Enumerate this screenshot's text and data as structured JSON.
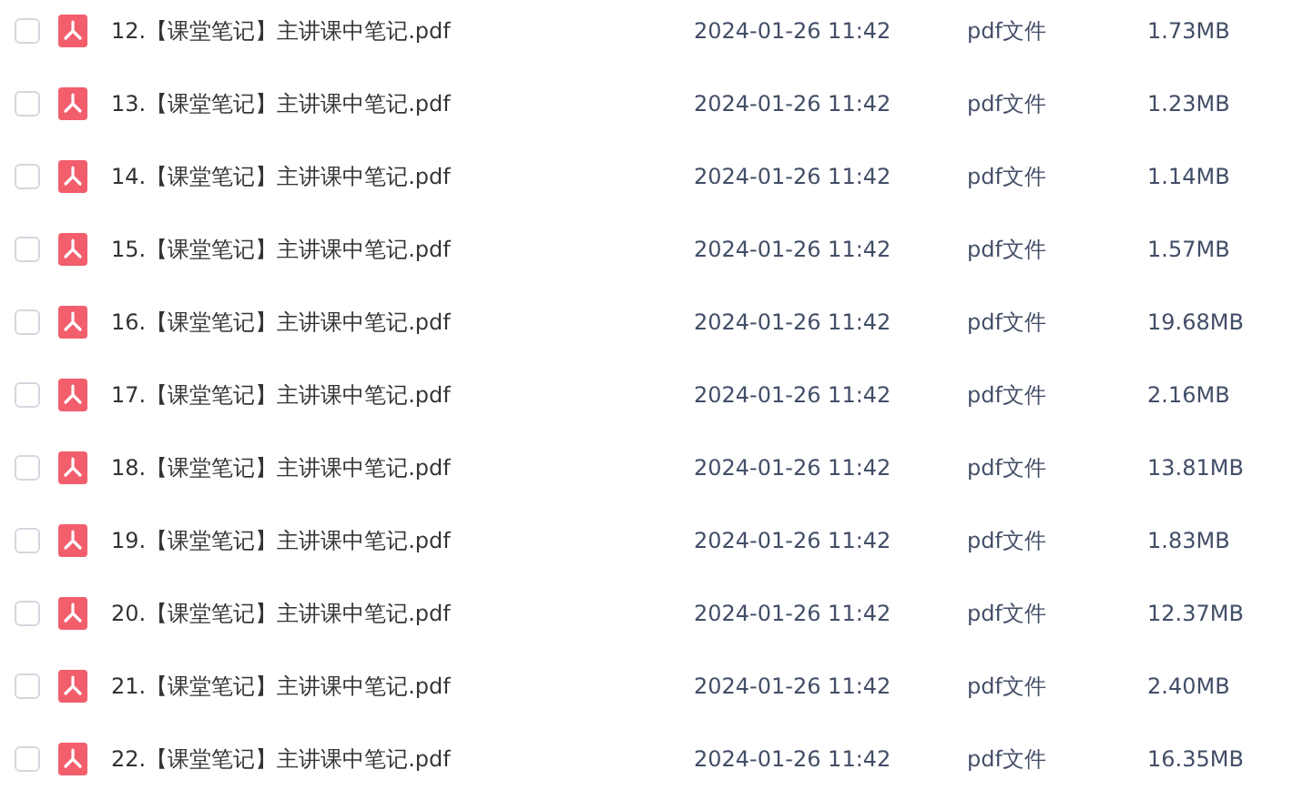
{
  "files": [
    {
      "name": "12.【课堂笔记】主讲课中笔记.pdf",
      "date": "2024-01-26 11:42",
      "type": "pdf文件",
      "size": "1.73MB",
      "checked": false
    },
    {
      "name": "13.【课堂笔记】主讲课中笔记.pdf",
      "date": "2024-01-26 11:42",
      "type": "pdf文件",
      "size": "1.23MB",
      "checked": false
    },
    {
      "name": "14.【课堂笔记】主讲课中笔记.pdf",
      "date": "2024-01-26 11:42",
      "type": "pdf文件",
      "size": "1.14MB",
      "checked": false
    },
    {
      "name": "15.【课堂笔记】主讲课中笔记.pdf",
      "date": "2024-01-26 11:42",
      "type": "pdf文件",
      "size": "1.57MB",
      "checked": false
    },
    {
      "name": "16.【课堂笔记】主讲课中笔记.pdf",
      "date": "2024-01-26 11:42",
      "type": "pdf文件",
      "size": "19.68MB",
      "checked": false
    },
    {
      "name": "17.【课堂笔记】主讲课中笔记.pdf",
      "date": "2024-01-26 11:42",
      "type": "pdf文件",
      "size": "2.16MB",
      "checked": false
    },
    {
      "name": "18.【课堂笔记】主讲课中笔记.pdf",
      "date": "2024-01-26 11:42",
      "type": "pdf文件",
      "size": "13.81MB",
      "checked": false
    },
    {
      "name": "19.【课堂笔记】主讲课中笔记.pdf",
      "date": "2024-01-26 11:42",
      "type": "pdf文件",
      "size": "1.83MB",
      "checked": false
    },
    {
      "name": "20.【课堂笔记】主讲课中笔记.pdf",
      "date": "2024-01-26 11:42",
      "type": "pdf文件",
      "size": "12.37MB",
      "checked": false
    },
    {
      "name": "21.【课堂笔记】主讲课中笔记.pdf",
      "date": "2024-01-26 11:42",
      "type": "pdf文件",
      "size": "2.40MB",
      "checked": false
    },
    {
      "name": "22.【课堂笔记】主讲课中笔记.pdf",
      "date": "2024-01-26 11:42",
      "type": "pdf文件",
      "size": "16.35MB",
      "checked": false
    }
  ]
}
